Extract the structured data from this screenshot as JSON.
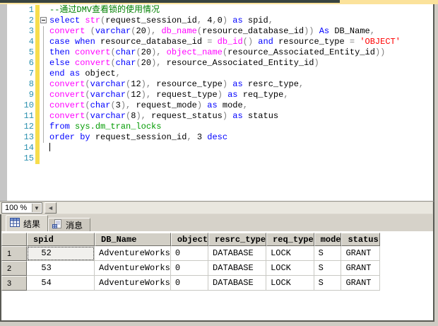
{
  "colors": {
    "comment": "#008000",
    "keyword": "#0000ff",
    "function": "#ff00ff",
    "string": "#ff0000",
    "operator": "#808080",
    "identifier": "#000000",
    "system_object": "#009b00",
    "line_number": "#2b91af",
    "change_bar": "#f7dd4c",
    "editor_bg": "#ffffff",
    "chrome_bg": "#d6d2c9",
    "top_bar_dark": "#394440",
    "top_bar_yellow": "#fbe29b",
    "grid_header_bg": "#d2cfc6",
    "grid_line": "#c9c9c4",
    "selected_cell_bg": "#f1f0ed"
  },
  "editor": {
    "zoom_value": "100 %",
    "lines": [
      {
        "n": "1",
        "tokens": [
          [
            "comment",
            "--通过DMV查看锁的使用情况"
          ]
        ]
      },
      {
        "n": "2",
        "fold": "start",
        "tokens": [
          [
            "keyword",
            "select "
          ],
          [
            "function",
            "str"
          ],
          [
            "operator",
            "("
          ],
          [
            "identifier",
            "request_session_id"
          ],
          [
            "operator",
            ", "
          ],
          [
            "identifier",
            "4"
          ],
          [
            "operator",
            ","
          ],
          [
            "identifier",
            "0"
          ],
          [
            "operator",
            ") "
          ],
          [
            "keyword",
            "as "
          ],
          [
            "identifier",
            "spid"
          ],
          [
            "operator",
            ","
          ]
        ]
      },
      {
        "n": "3",
        "fold": "line",
        "tokens": [
          [
            "function",
            "convert "
          ],
          [
            "operator",
            "("
          ],
          [
            "keyword",
            "varchar"
          ],
          [
            "operator",
            "("
          ],
          [
            "identifier",
            "20"
          ],
          [
            "operator",
            "), "
          ],
          [
            "function",
            "db_name"
          ],
          [
            "operator",
            "("
          ],
          [
            "identifier",
            "resource_database_id"
          ],
          [
            "operator",
            ")) "
          ],
          [
            "keyword",
            "As "
          ],
          [
            "identifier",
            "DB_Name"
          ],
          [
            "operator",
            ","
          ]
        ]
      },
      {
        "n": "4",
        "fold": "line",
        "tokens": [
          [
            "keyword",
            "case when "
          ],
          [
            "identifier",
            "resource_database_id "
          ],
          [
            "operator",
            "= "
          ],
          [
            "function",
            "db_id"
          ],
          [
            "operator",
            "() "
          ],
          [
            "keyword",
            "and "
          ],
          [
            "identifier",
            "resource_type "
          ],
          [
            "operator",
            "= "
          ],
          [
            "string",
            "'OBJECT'"
          ]
        ]
      },
      {
        "n": "5",
        "fold": "line",
        "tokens": [
          [
            "keyword",
            "then "
          ],
          [
            "function",
            "convert"
          ],
          [
            "operator",
            "("
          ],
          [
            "keyword",
            "char"
          ],
          [
            "operator",
            "("
          ],
          [
            "identifier",
            "20"
          ],
          [
            "operator",
            "), "
          ],
          [
            "function",
            "object_name"
          ],
          [
            "operator",
            "("
          ],
          [
            "identifier",
            "resource_Associated_Entity_id"
          ],
          [
            "operator",
            "))"
          ]
        ]
      },
      {
        "n": "6",
        "fold": "line",
        "tokens": [
          [
            "keyword",
            "else "
          ],
          [
            "function",
            "convert"
          ],
          [
            "operator",
            "("
          ],
          [
            "keyword",
            "char"
          ],
          [
            "operator",
            "("
          ],
          [
            "identifier",
            "20"
          ],
          [
            "operator",
            "), "
          ],
          [
            "identifier",
            "resource_Associated_Entity_id"
          ],
          [
            "operator",
            ")"
          ]
        ]
      },
      {
        "n": "7",
        "fold": "line",
        "tokens": [
          [
            "keyword",
            "end as "
          ],
          [
            "identifier",
            "object"
          ],
          [
            "operator",
            ","
          ]
        ]
      },
      {
        "n": "8",
        "fold": "line",
        "tokens": [
          [
            "function",
            "convert"
          ],
          [
            "operator",
            "("
          ],
          [
            "keyword",
            "varchar"
          ],
          [
            "operator",
            "("
          ],
          [
            "identifier",
            "12"
          ],
          [
            "operator",
            "), "
          ],
          [
            "identifier",
            "resource_type"
          ],
          [
            "operator",
            ") "
          ],
          [
            "keyword",
            "as "
          ],
          [
            "identifier",
            "resrc_type"
          ],
          [
            "operator",
            ","
          ]
        ]
      },
      {
        "n": "9",
        "fold": "line",
        "tokens": [
          [
            "function",
            "convert"
          ],
          [
            "operator",
            "("
          ],
          [
            "keyword",
            "varchar"
          ],
          [
            "operator",
            "("
          ],
          [
            "identifier",
            "12"
          ],
          [
            "operator",
            "), "
          ],
          [
            "identifier",
            "request_type"
          ],
          [
            "operator",
            ") "
          ],
          [
            "keyword",
            "as "
          ],
          [
            "identifier",
            "req_type"
          ],
          [
            "operator",
            ","
          ]
        ]
      },
      {
        "n": "10",
        "fold": "line",
        "tokens": [
          [
            "function",
            "convert"
          ],
          [
            "operator",
            "("
          ],
          [
            "keyword",
            "char"
          ],
          [
            "operator",
            "("
          ],
          [
            "identifier",
            "3"
          ],
          [
            "operator",
            "), "
          ],
          [
            "identifier",
            "request_mode"
          ],
          [
            "operator",
            ") "
          ],
          [
            "keyword",
            "as "
          ],
          [
            "identifier",
            "mode"
          ],
          [
            "operator",
            ","
          ]
        ]
      },
      {
        "n": "11",
        "fold": "line",
        "tokens": [
          [
            "function",
            "convert"
          ],
          [
            "operator",
            "("
          ],
          [
            "keyword",
            "varchar"
          ],
          [
            "operator",
            "("
          ],
          [
            "identifier",
            "8"
          ],
          [
            "operator",
            "), "
          ],
          [
            "identifier",
            "request_status"
          ],
          [
            "operator",
            ") "
          ],
          [
            "keyword",
            "as "
          ],
          [
            "identifier",
            "status"
          ]
        ]
      },
      {
        "n": "12",
        "fold": "line",
        "tokens": [
          [
            "keyword",
            "from "
          ],
          [
            "system",
            "sys.dm_tran_locks"
          ]
        ]
      },
      {
        "n": "13",
        "fold": "line",
        "tokens": [
          [
            "keyword",
            "order by "
          ],
          [
            "identifier",
            "request_session_id"
          ],
          [
            "operator",
            ", "
          ],
          [
            "identifier",
            "3 "
          ],
          [
            "keyword",
            "desc"
          ]
        ]
      },
      {
        "n": "14",
        "caret": true,
        "tokens": []
      },
      {
        "n": "15",
        "tokens": []
      }
    ]
  },
  "results": {
    "tabs": [
      {
        "label": "结果",
        "icon": "results-grid-icon",
        "active": true
      },
      {
        "label": "消息",
        "icon": "messages-icon",
        "active": false
      }
    ],
    "grid": {
      "columns": [
        "spid",
        "DB_Name",
        "object",
        "resrc_type",
        "req_type",
        "mode",
        "status"
      ],
      "rows": [
        {
          "num": "1",
          "cells": [
            "  52",
            "AdventureWorks",
            "0",
            "DATABASE",
            "LOCK",
            "S",
            "GRANT"
          ]
        },
        {
          "num": "2",
          "cells": [
            "  53",
            "AdventureWorks",
            "0",
            "DATABASE",
            "LOCK",
            "S",
            "GRANT"
          ]
        },
        {
          "num": "3",
          "cells": [
            "  54",
            "AdventureWorks",
            "0",
            "DATABASE",
            "LOCK",
            "S",
            "GRANT"
          ]
        }
      ],
      "selected": {
        "row": 0,
        "col": 0
      }
    }
  }
}
